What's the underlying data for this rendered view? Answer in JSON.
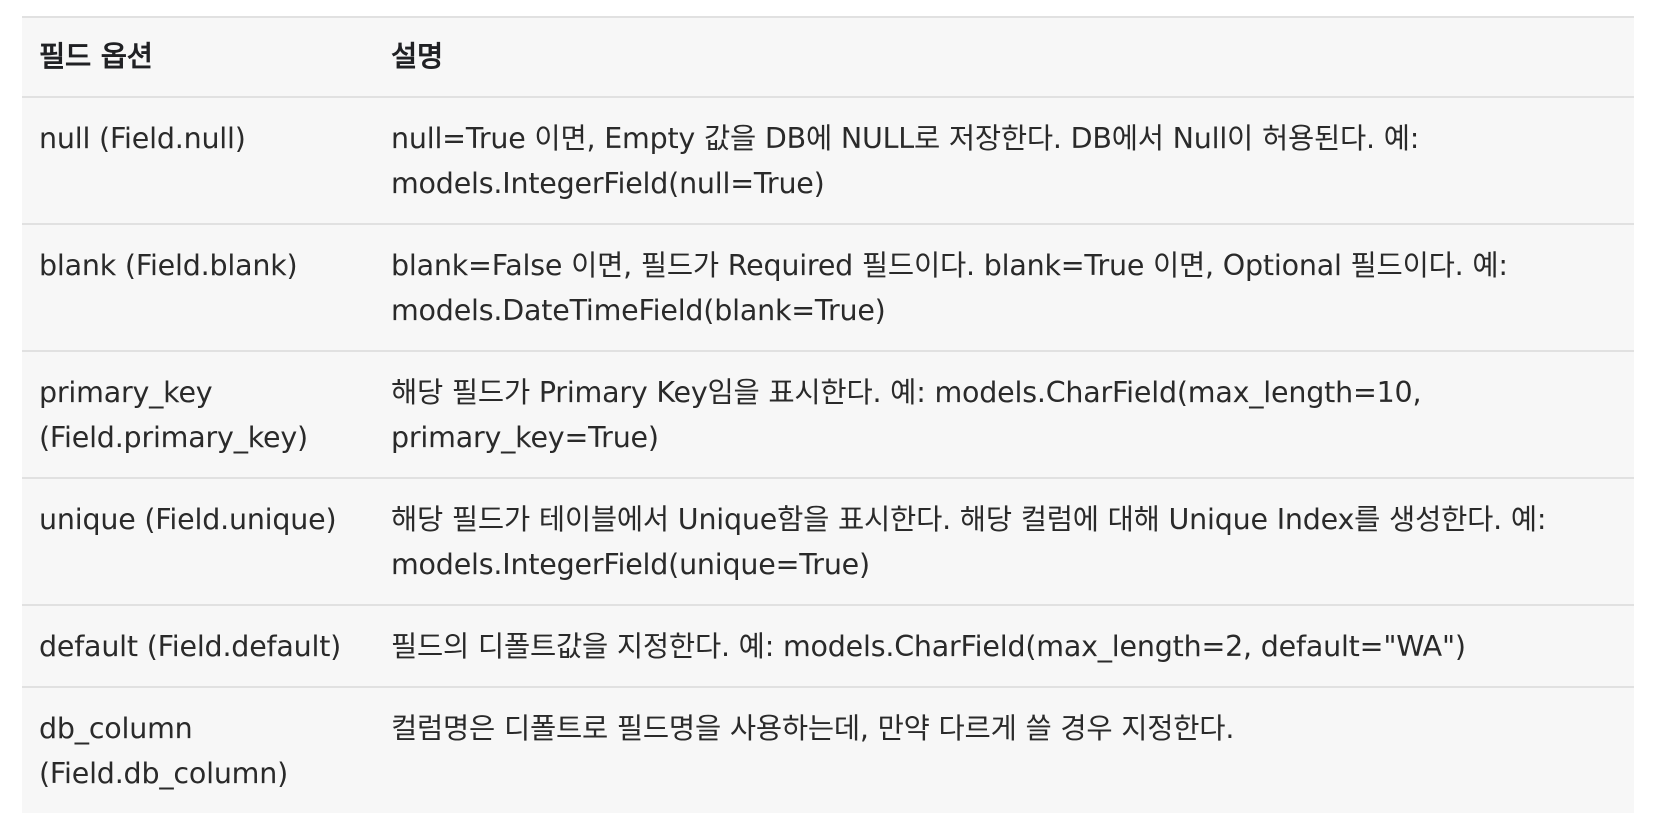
{
  "table": {
    "headers": [
      "필드 옵션",
      "설명"
    ],
    "rows": [
      {
        "option": "null (Field.null)",
        "description": "null=True 이면, Empty 값을 DB에 NULL로 저장한다. DB에서 Null이 허용된다. 예: models.IntegerField(null=True)"
      },
      {
        "option": "blank (Field.blank)",
        "description": "blank=False 이면, 필드가 Required 필드이다. blank=True 이면, Optional 필드이다. 예: models.DateTimeField(blank=True)"
      },
      {
        "option": "primary_key (Field.primary_key)",
        "description": "해당 필드가 Primary Key임을 표시한다. 예: models.CharField(max_length=10, primary_key=True)"
      },
      {
        "option": "unique (Field.unique)",
        "description": "해당 필드가 테이블에서 Unique함을 표시한다. 해당 컬럼에 대해 Unique Index를 생성한다. 예: models.IntegerField(unique=True)"
      },
      {
        "option": "default (Field.default)",
        "description": "필드의 디폴트값을 지정한다. 예: models.CharField(max_length=2, default=\"WA\")"
      },
      {
        "option": "db_column (Field.db_column)",
        "description": "컬럼명은 디폴트로 필드명을 사용하는데, 만약 다르게 쓸 경우 지정한다."
      }
    ]
  }
}
